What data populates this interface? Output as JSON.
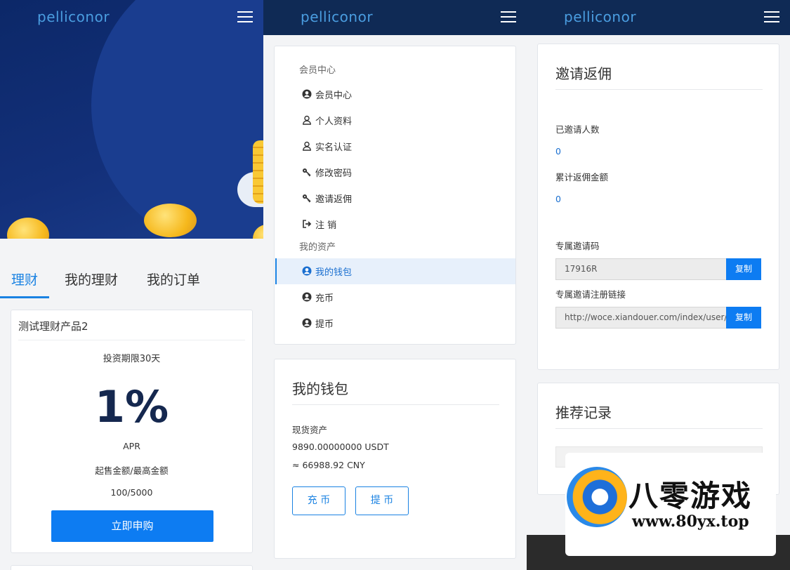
{
  "brand": "pelliconor",
  "panel1": {
    "tabs": [
      "理财",
      "我的理财",
      "我的订单"
    ],
    "product": {
      "title": "测试理财产品2",
      "term": "投资期限30天",
      "rate": "1%",
      "rate_label": "APR",
      "amount_label": "起售金额/最高金额",
      "amount_value": "100/5000",
      "buy_button": "立即申购"
    }
  },
  "panel2": {
    "menu": {
      "section1": "会员中心",
      "items1": [
        {
          "label": "会员中心",
          "icon": "user-circle-icon"
        },
        {
          "label": "个人资料",
          "icon": "user-outline-icon"
        },
        {
          "label": "实名认证",
          "icon": "user-outline-icon"
        },
        {
          "label": "修改密码",
          "icon": "key-icon"
        },
        {
          "label": "邀请返佣",
          "icon": "key-icon"
        },
        {
          "label": "注 销",
          "icon": "logout-icon"
        }
      ],
      "section2": "我的资产",
      "items2": [
        {
          "label": "我的钱包",
          "icon": "user-circle-icon",
          "active": true
        },
        {
          "label": "充币",
          "icon": "user-circle-icon"
        },
        {
          "label": "提币",
          "icon": "user-circle-icon"
        }
      ]
    },
    "wallet": {
      "title": "我的钱包",
      "spot_label": "现货资产",
      "usdt": "9890.00000000 USDT",
      "cny": "≈ 66988.92 CNY",
      "deposit_button": "充 币",
      "withdraw_button": "提 币"
    }
  },
  "panel3": {
    "invite": {
      "title": "邀请返佣",
      "invited_label": "已邀请人数",
      "invited_value": "0",
      "commission_label": "累计返佣金额",
      "commission_value": "0",
      "code_label": "专属邀请码",
      "code_value": "17916R",
      "copy_label": "复制",
      "link_label": "专属邀请注册链接",
      "link_value": "http://woce.xiandouer.com/index/user/reg"
    },
    "records": {
      "title": "推荐记录"
    }
  },
  "watermark": {
    "title": "八零游戏",
    "url": "www.80yx.top"
  },
  "colors": {
    "navbar": "#0f2a55",
    "accent": "#0d7cf2",
    "brand_text": "#4a9de0"
  }
}
